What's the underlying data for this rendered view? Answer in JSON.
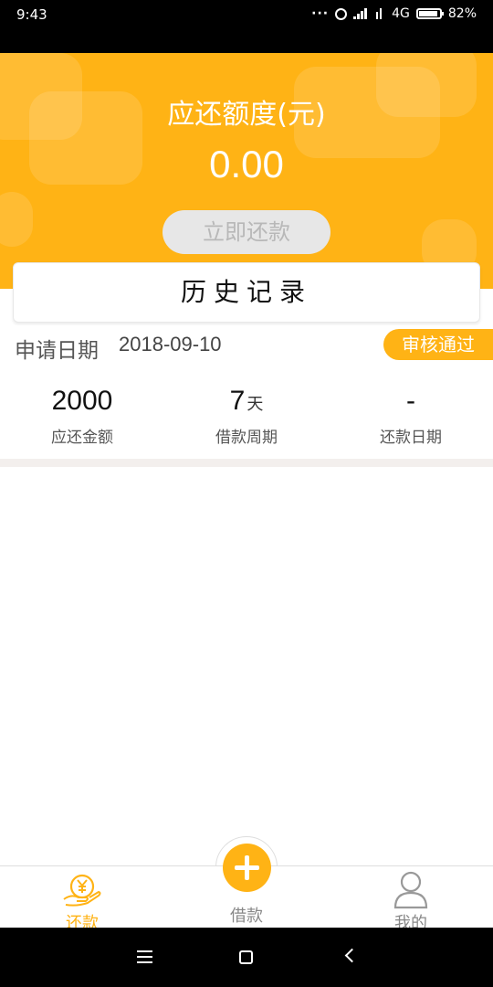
{
  "status_bar": {
    "time": "9:43",
    "network": "4G",
    "battery": "82%",
    "battery_level": 0.82
  },
  "header": {
    "title": "应还额度(元)",
    "amount": "0.00",
    "repay_button": "立即还款"
  },
  "history": {
    "title": "历史记录"
  },
  "record": {
    "date_label": "申请日期",
    "date_value": "2018-09-10",
    "status": "审核通过",
    "amount": {
      "value": "2000",
      "label": "应还金额"
    },
    "period": {
      "value": "7",
      "unit": "天",
      "label": "借款周期"
    },
    "repay_date": {
      "value": "-",
      "label": "还款日期"
    }
  },
  "tabs": {
    "repay": {
      "label": "还款",
      "active": true
    },
    "borrow": {
      "label": "借款"
    },
    "mine": {
      "label": "我的"
    }
  },
  "colors": {
    "accent": "#ffb315",
    "divider": "#f3efed",
    "inactive_tab": "#888888"
  },
  "icons": {
    "repay": "yen-hand-icon",
    "borrow": "plus-icon",
    "mine": "user-icon"
  }
}
